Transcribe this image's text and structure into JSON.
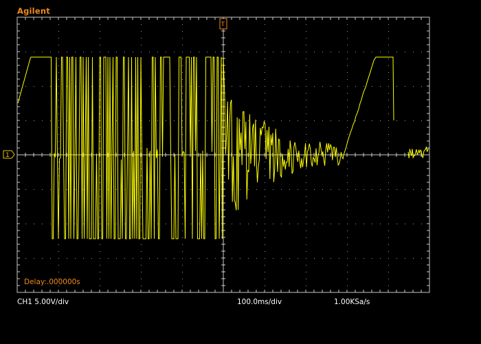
{
  "header": {
    "brand": "Agilent"
  },
  "markers": {
    "channel_ground": "1",
    "trigger_position": "T"
  },
  "overlay": {
    "delay": "Delay:.000000s"
  },
  "status_bar": {
    "ch1_scale": "CH1 5.00V/div",
    "timebase": "100.0ms/div",
    "sample_rate": "1.00KSa/s"
  },
  "colors": {
    "trace": "#ffff00",
    "brand": "#f08a1e",
    "graticule": "#c8c8c8",
    "background": "#000000"
  },
  "icons": {
    "ground_marker": "channel-1-ground-marker-icon",
    "trigger_marker": "trigger-position-marker-icon"
  }
}
